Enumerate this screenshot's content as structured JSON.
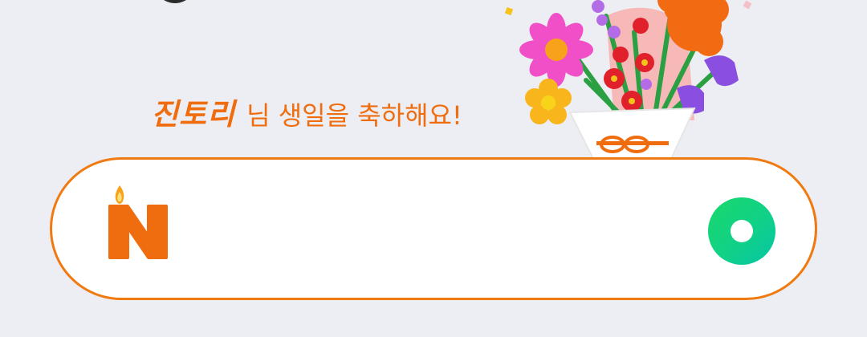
{
  "greeting": {
    "name": "진토리",
    "message": "님 생일을 축하해요!"
  },
  "search": {
    "value": "",
    "placeholder": ""
  },
  "colors": {
    "accent": "#f06d0f",
    "border": "#f07a10",
    "green": "#19d86a",
    "background": "#eceef3"
  },
  "icons": {
    "logo": "naver-birthday-logo-icon",
    "bouquet": "flower-bouquet-icon",
    "green_button": "green-circle-icon"
  }
}
